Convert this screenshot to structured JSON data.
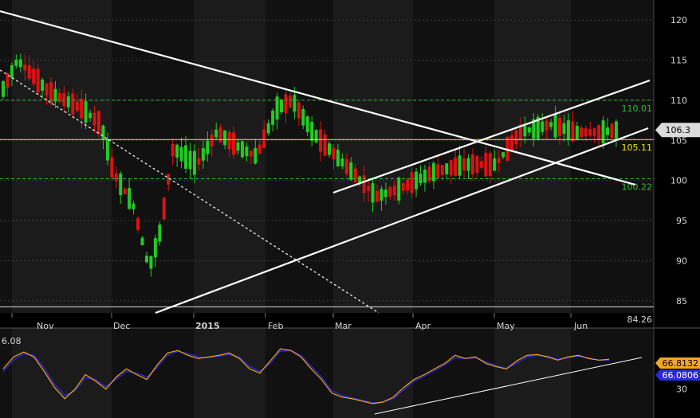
{
  "colors": {
    "background": "#000000",
    "band_dark": "#111111",
    "band_light": "#1b1b1b",
    "up": "#22cc22",
    "down": "#dd1111",
    "trendline": "#ffffff",
    "level_green": "#33bb33",
    "level_yellow": "#e8e800",
    "osc_orange": "#f5a623",
    "osc_blue": "#2a2adc"
  },
  "chart_data": [
    {
      "type": "candlestick",
      "title": "",
      "x_labels": [
        "Nov",
        "Dec",
        "2015",
        "Feb",
        "Mar",
        "Apr",
        "May",
        "Jun"
      ],
      "y_ticks": [
        85,
        90,
        95,
        100,
        105,
        110,
        115,
        120
      ],
      "ylim": [
        83.5,
        122.5
      ],
      "grid": "horizontal dashed",
      "horizontal_levels": [
        {
          "value": 110.01,
          "label": "110.01",
          "color": "green"
        },
        {
          "value": 105.11,
          "label": "105.11",
          "color": "yellow"
        },
        {
          "value": 100.22,
          "label": "100.22",
          "color": "green"
        }
      ],
      "last_price_label": "106.3",
      "last_price": 106.3,
      "partial_bottom_label": "84.26",
      "bottom_level": 84.26
    },
    {
      "type": "line",
      "title": "",
      "top_left_label": "6.08",
      "y_ticks": [
        30
      ],
      "value_labels": [
        "66.8132",
        "66.0806"
      ],
      "series": [
        {
          "values": [
            55,
            70,
            76,
            70,
            52,
            32,
            18,
            30,
            48,
            40,
            30,
            45,
            55,
            48,
            42,
            60,
            75,
            78,
            72,
            68,
            70,
            72,
            75,
            68,
            55,
            50,
            65,
            80,
            78,
            70,
            55,
            42,
            25,
            20,
            18,
            15,
            12,
            14,
            20,
            32,
            42,
            48,
            55,
            62,
            72,
            68,
            70,
            62,
            58,
            55,
            65,
            72,
            73,
            70,
            66,
            70,
            72,
            68,
            66,
            67
          ]
        },
        {
          "values": [
            52,
            66,
            74,
            72,
            56,
            36,
            22,
            28,
            44,
            42,
            33,
            42,
            52,
            50,
            45,
            57,
            72,
            77,
            74,
            70,
            69,
            71,
            73,
            70,
            58,
            52,
            62,
            77,
            78,
            72,
            58,
            45,
            28,
            22,
            19,
            16,
            13,
            14,
            18,
            29,
            40,
            46,
            53,
            60,
            69,
            68,
            69,
            64,
            59,
            56,
            62,
            70,
            72,
            71,
            67,
            69,
            71,
            69,
            66,
            66
          ]
        }
      ]
    }
  ]
}
